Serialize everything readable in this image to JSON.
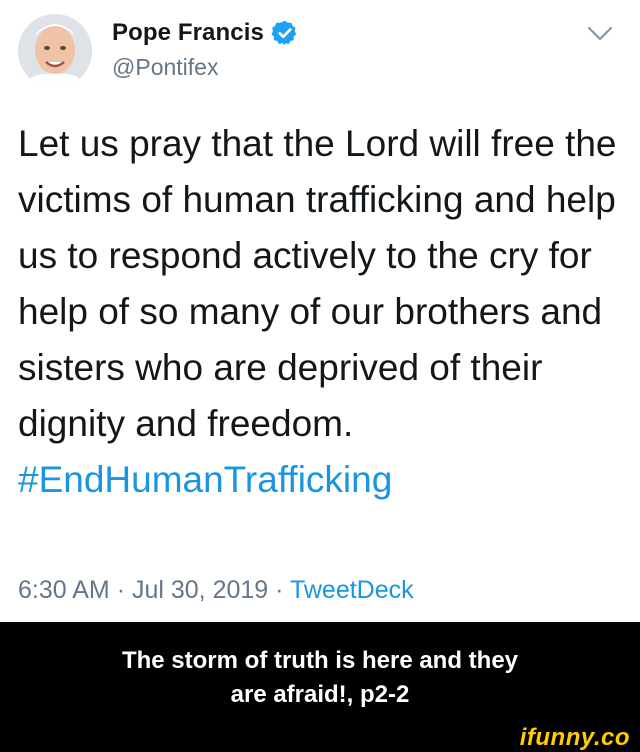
{
  "tweet": {
    "author_name": "Pope Francis",
    "author_handle": "@Pontifex",
    "text": "Let us pray that the Lord will free the victims of human trafficking and help us to respond actively to the cry for help of so many of our brothers and sisters who are deprived of their dignity and freedom.",
    "hashtag": "#EndHumanTrafficking",
    "time": "6:30 AM",
    "date": "Jul 30, 2019",
    "source": "TweetDeck",
    "separator": "·",
    "accent_color": "#1b95e0",
    "verified_icon": "verified-badge-icon"
  },
  "caption": {
    "text": "The storm of truth is here and they are afraid!, p2-2"
  },
  "watermark": {
    "text": "ifunny.co",
    "color": "#ffcc00"
  }
}
